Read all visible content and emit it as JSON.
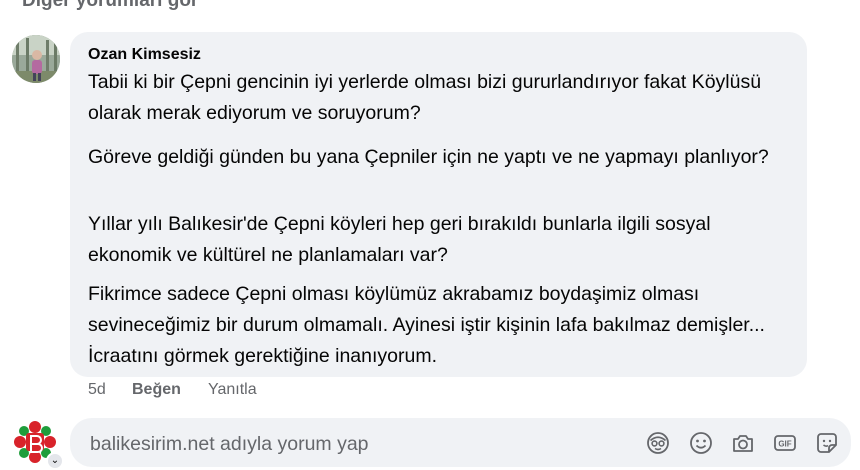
{
  "thread": {
    "see_more_label": "Diğer yorumları gör"
  },
  "comment": {
    "author": "Ozan Kimsesiz",
    "paragraphs": [
      "Tabii ki bir Çepni gencinin iyi yerlerde olması bizi gururlandırıyor fakat Köylüsü olarak merak ediyorum ve soruyorum?",
      "Göreve geldiği günden bu yana Çepniler için ne yaptı ve ne yapmayı planlıyor?",
      "Yıllar yılı Balıkesir'de Çepni köyleri hep geri bırakıldı bunlarla ilgili sosyal ekonomik ve kültürel ne planlamaları var?",
      "Fikrimce sadece Çepni olması köylümüz akrabamız boydaşimiz olması sevineceğimiz bir durum olmamalı. Ayinesi iştir kişinin lafa bakılmaz demişler... İcraatını görmek gerektiğine inanıyorum."
    ],
    "time": "5d",
    "like_label": "Beğen",
    "reply_label": "Yanıtla"
  },
  "composer": {
    "placeholder": "balikesirim.net adıyla yorum yap",
    "value": "",
    "tools": [
      "avatar-sticker-icon",
      "emoji-icon",
      "camera-icon",
      "gif-icon",
      "sticker-icon"
    ]
  },
  "colors": {
    "bubble_bg": "#f0f2f5",
    "muted_text": "#65676b",
    "brand_red": "#d8232a",
    "brand_green": "#1f9d3b"
  }
}
